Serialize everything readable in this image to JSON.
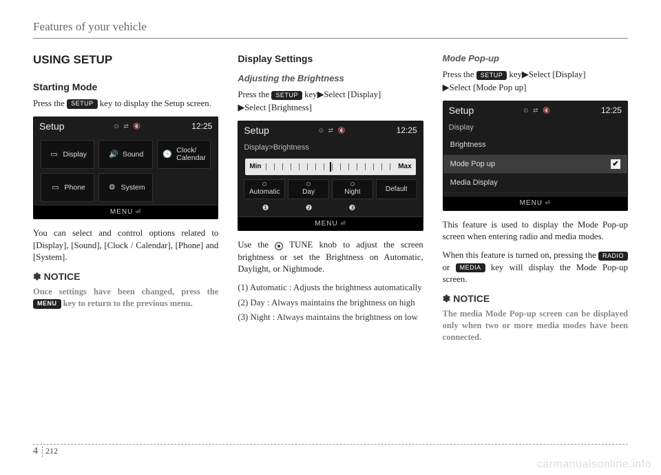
{
  "header": "Features of your vehicle",
  "col1": {
    "h2": "USING SETUP",
    "h3": "Starting Mode",
    "p1a": "Press the ",
    "key_setup": "SETUP",
    "p1b": " key to display the Setup screen.",
    "screen": {
      "title": "Setup",
      "time": "12:25",
      "tiles": [
        "Display",
        "Sound",
        "Clock/\nCalendar",
        "Phone",
        "System"
      ],
      "menu": "MENU"
    },
    "p2": "You can select and control options related to [Display], [Sound], [Clock / Calendar], [Phone] and [System].",
    "notice_h": "✽ NOTICE",
    "notice_a": "Once settings have been changed, press the ",
    "key_menu": "MENU",
    "notice_b": " key to return to the previous menu."
  },
  "col2": {
    "h3": "Display Settings",
    "h4": "Adjusting the Brightness",
    "p1a": "Press the ",
    "key_setup": "SETUP",
    "p1b": " key",
    "p1c": "Select [Display] ",
    "p1d": "Select [Brightness]",
    "screen": {
      "title": "Setup",
      "time": "12:25",
      "crumb": "Display>Brightness",
      "min": "Min",
      "max": "Max",
      "modes": [
        "Automatic",
        "Day",
        "Night"
      ],
      "default": "Default",
      "nums": [
        "❶",
        "❷",
        "❸"
      ],
      "menu": "MENU"
    },
    "p2a": "Use the ",
    "p2b": " TUNE knob to adjust the screen brightness or set the Brightness on Automatic, Daylight, or Nightmode.",
    "li1": "(1) Automatic : Adjusts the bright­ness automatically",
    "li2": "(2) Day : Always maintains the bright­ness on high",
    "li3": "(3) Night : Always maintains the brightness on low"
  },
  "col3": {
    "h4": "Mode Pop-up",
    "p1a": "Press the ",
    "key_setup": "SETUP",
    "p1b": " key",
    "p1c": "Select [Display] ",
    "p1d": "Select [Mode Pop up]",
    "screen": {
      "title": "Setup",
      "time": "12:25",
      "crumb": "Display",
      "items": [
        "Brightness",
        "Mode Pop up",
        "Media Display"
      ],
      "menu": "MENU"
    },
    "p2": "This feature is used to display the Mode Pop-up screen when entering radio and media modes.",
    "p3a": "When this feature is turned on, pressing the ",
    "key_radio": "RADIO",
    "p3b": " or ",
    "key_media": "MEDIA",
    "p3c": " key will display the Mode Pop-up screen.",
    "notice_h": "✽ NOTICE",
    "notice": "The media Mode Pop-up screen can be displayed only when two or more media modes have been connected."
  },
  "footer": {
    "section": "4",
    "page": "212"
  },
  "watermark": "carmanualsonline.info"
}
